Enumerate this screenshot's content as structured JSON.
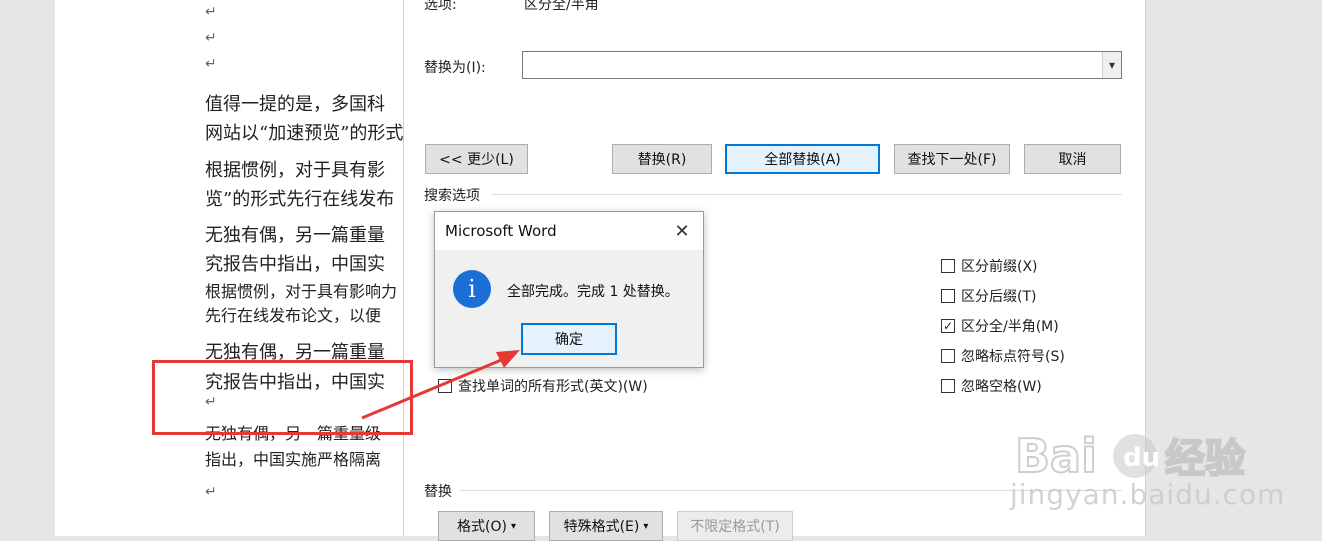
{
  "document": {
    "lines": [
      "值得一提的是，多国科",
      "网站以“加速预览”的形式",
      "根据惯例，对于具有影",
      "览”的形式先行在线发布",
      "无独有偶，另一篇重量",
      "究报告中指出，中国实",
      "根据惯例，对于具有影响力",
      "先行在线发布论文，以便",
      "无独有偶，另一篇重量",
      "究报告中指出，中国实",
      "无独有偶，另一篇重量级",
      "指出，中国实施严格隔离"
    ],
    "paragraph_mark": "↵"
  },
  "find_replace": {
    "options_label": "选项:",
    "options_value": "区分全/半角",
    "replace_with_label": "替换为(I):",
    "replace_with_value": "",
    "buttons": {
      "less": "<< 更少(L)",
      "replace": "替换(R)",
      "replace_all": "全部替换(A)",
      "find_next": "查找下一处(F)",
      "cancel": "取消"
    },
    "search_options_label": "搜索选项",
    "checkboxes": {
      "match_prefix": {
        "label": "区分前缀(X)",
        "checked": false
      },
      "match_suffix": {
        "label": "区分后缀(T)",
        "checked": false
      },
      "match_width": {
        "label": "区分全/半角(M)",
        "checked": true
      },
      "ignore_punct": {
        "label": "忽略标点符号(S)",
        "checked": false
      },
      "ignore_space": {
        "label": "忽略空格(W)",
        "checked": false
      },
      "all_word_forms": {
        "label": "查找单词的所有形式(英文)(W)",
        "checked": false
      }
    },
    "replace_section_label": "替换",
    "format_buttons": {
      "format": "格式(O)",
      "special": "特殊格式(E)",
      "no_formatting": "不限定格式(T)"
    }
  },
  "message_box": {
    "title": "Microsoft Word",
    "message": "全部完成。完成 1 处替换。",
    "ok_label": "确定",
    "icon": "info-icon"
  },
  "watermark": {
    "url": "jingyan.baidu.com",
    "logo_text": "Bai du 经验"
  },
  "colors": {
    "accent": "#0078d7",
    "annotation_red": "#e53935",
    "info_blue": "#1c6fd6"
  }
}
